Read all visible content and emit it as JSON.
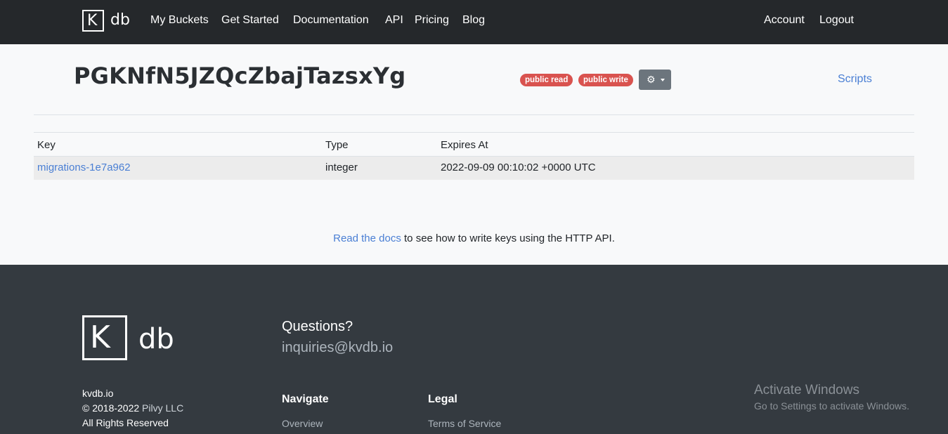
{
  "nav": {
    "logo_k": "K",
    "logo_db": "db",
    "links": [
      "My Buckets",
      "Get Started",
      "Documentation",
      "API",
      "Pricing",
      "Blog"
    ],
    "account": "Account",
    "logout": "Logout"
  },
  "bucket": {
    "title": "PGKNfN5JZQcZbajTazsxYg",
    "badges": [
      "public read",
      "public write"
    ],
    "settings_icon": "gear-icon",
    "scripts_label": "Scripts"
  },
  "table": {
    "headers": [
      "Key",
      "Type",
      "Expires At"
    ],
    "rows": [
      {
        "key": "migrations-1e7a962",
        "type": "integer",
        "expires_at": "2022-09-09 00:10:02 +0000 UTC"
      }
    ]
  },
  "docs": {
    "link_text": "Read the docs",
    "rest_text": " to see how to write keys using the HTTP API."
  },
  "footer": {
    "site": "kvdb.io",
    "copyright_prefix": "© 2018-2022",
    "company": "Pilvy LLC",
    "rights": "All Rights Reserved",
    "questions_heading": "Questions?",
    "email": "inquiries@kvdb.io",
    "navigate_heading": "Navigate",
    "navigate_first": "Overview",
    "legal_heading": "Legal",
    "legal_first": "Terms of Service"
  },
  "watermark": {
    "title": "Activate Windows",
    "subtitle": "Go to Settings to activate Windows."
  },
  "colors": {
    "nav_bg": "#25282b",
    "footer_bg": "#343a40",
    "badge_red": "#d9534f",
    "link_blue": "#4a7fd4"
  }
}
